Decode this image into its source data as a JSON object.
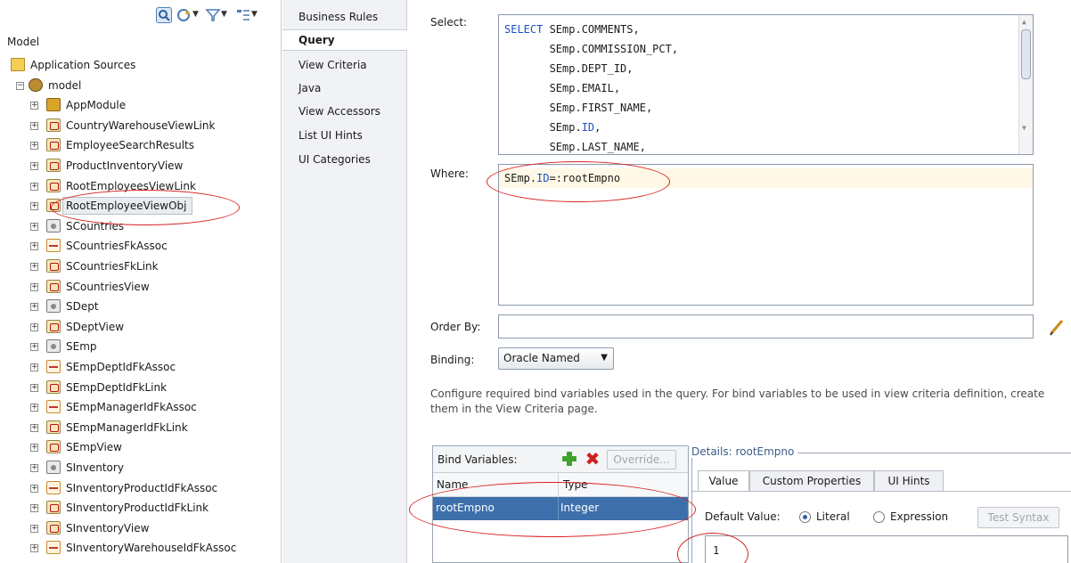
{
  "tree": {
    "root": "Model",
    "nodes": [
      {
        "label": "Application Sources",
        "icon": "folder-icon"
      },
      {
        "label": "model",
        "icon": "model-icon"
      },
      {
        "label": "AppModule",
        "icon": "am-icon"
      },
      {
        "label": "CountryWarehouseViewLink",
        "icon": "vo-icon"
      },
      {
        "label": "EmployeeSearchResults",
        "icon": "vo-icon"
      },
      {
        "label": "ProductInventoryView",
        "icon": "vo-icon"
      },
      {
        "label": "RootEmployeesViewLink",
        "icon": "vo-icon"
      },
      {
        "label": "RootEmployeeViewObj",
        "icon": "vo-icon"
      },
      {
        "label": "SCountries",
        "icon": "eo-icon"
      },
      {
        "label": "SCountriesFkAssoc",
        "icon": "assoc-icon"
      },
      {
        "label": "SCountriesFkLink",
        "icon": "vo-icon"
      },
      {
        "label": "SCountriesView",
        "icon": "vo-icon"
      },
      {
        "label": "SDept",
        "icon": "eo-icon"
      },
      {
        "label": "SDeptView",
        "icon": "vo-icon"
      },
      {
        "label": "SEmp",
        "icon": "eo-icon"
      },
      {
        "label": "SEmpDeptIdFkAssoc",
        "icon": "assoc-icon"
      },
      {
        "label": "SEmpDeptIdFkLink",
        "icon": "vo-icon"
      },
      {
        "label": "SEmpManagerIdFkAssoc",
        "icon": "assoc-icon"
      },
      {
        "label": "SEmpManagerIdFkLink",
        "icon": "vo-icon"
      },
      {
        "label": "SEmpView",
        "icon": "vo-icon"
      },
      {
        "label": "SInventory",
        "icon": "eo-icon"
      },
      {
        "label": "SInventoryProductIdFkAssoc",
        "icon": "assoc-icon"
      },
      {
        "label": "SInventoryProductIdFkLink",
        "icon": "vo-icon"
      },
      {
        "label": "SInventoryView",
        "icon": "vo-icon"
      },
      {
        "label": "SInventoryWarehouseIdFkAssoc",
        "icon": "assoc-icon"
      }
    ]
  },
  "nav": {
    "items": [
      "Business Rules",
      "Query",
      "View Criteria",
      "Java",
      "View Accessors",
      "List UI Hints",
      "UI Categories"
    ],
    "active": "Query"
  },
  "query": {
    "select_label": "Select:",
    "select_keyword": "SELECT",
    "select_lines": [
      " SEmp.COMMENTS,",
      "       SEmp.COMMISSION_PCT,",
      "       SEmp.DEPT_ID,",
      "       SEmp.EMAIL,",
      "       SEmp.FIRST_NAME,",
      "       SEmp.",
      "       SEmp.LAST_NAME,"
    ],
    "select_id_kw": "ID",
    "where_label": "Where:",
    "where_prefix": "SEmp.",
    "where_kw": "ID",
    "where_suffix": "=:rootEmpno",
    "orderby_label": "Order By:",
    "orderby_value": "",
    "binding_label": "Binding:",
    "binding_value": "Oracle Named",
    "help_text": "Configure required bind variables used in the query.  For bind variables to be used in view criteria definition, create them in the View Criteria page."
  },
  "bind_vars": {
    "title": "Bind Variables:",
    "override_label": "Override...",
    "columns": [
      "Name",
      "Type"
    ],
    "rows": [
      {
        "name": "rootEmpno",
        "type": "Integer"
      }
    ]
  },
  "details": {
    "title": "Details: rootEmpno",
    "tabs": [
      "Value",
      "Custom Properties",
      "UI Hints"
    ],
    "active_tab": "Value",
    "default_value_label": "Default Value:",
    "literal_label": "Literal",
    "expression_label": "Expression",
    "test_syntax_label": "Test Syntax",
    "value": "1",
    "selected_option": "Literal"
  },
  "colors": {
    "keyword": "#1c50c8",
    "selection": "#3d6fab",
    "annotation": "#d92020",
    "where_highlight": "#fff8e6"
  }
}
